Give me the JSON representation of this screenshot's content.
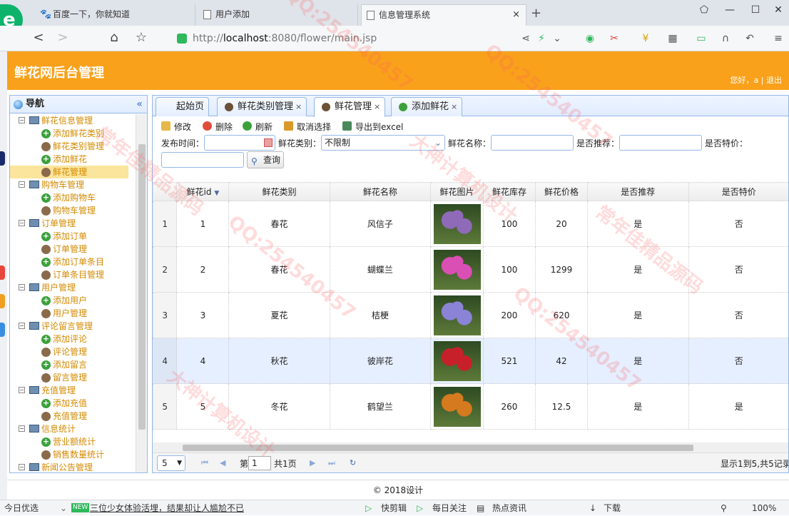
{
  "browser": {
    "tabs": [
      {
        "title": "百度一下，你就知道"
      },
      {
        "title": "用户添加"
      },
      {
        "title": "信息管理系统"
      }
    ],
    "new_tab": "+",
    "url_prefix": "http://",
    "url_host": "localhost",
    "url_path": ":8080/flower/main.jsp",
    "zoom": "100%"
  },
  "header": {
    "title": "鲜花网后台管理",
    "user_text": "您好，a | 退出"
  },
  "nav": {
    "title": "导航",
    "collapse": "«",
    "groups": [
      {
        "label": "鲜花信息管理",
        "items": [
          {
            "label": "添加鲜花类别",
            "type": "add"
          },
          {
            "label": "鲜花类别管理",
            "type": "man"
          },
          {
            "label": "添加鲜花",
            "type": "add"
          },
          {
            "label": "鲜花管理",
            "type": "man",
            "selected": true
          }
        ]
      },
      {
        "label": "购物车管理",
        "items": [
          {
            "label": "添加购物车",
            "type": "add"
          },
          {
            "label": "购物车管理",
            "type": "man"
          }
        ]
      },
      {
        "label": "订单管理",
        "items": [
          {
            "label": "添加订单",
            "type": "add"
          },
          {
            "label": "订单管理",
            "type": "man"
          },
          {
            "label": "添加订单条目",
            "type": "add"
          },
          {
            "label": "订单条目管理",
            "type": "man"
          }
        ]
      },
      {
        "label": "用户管理",
        "items": [
          {
            "label": "添加用户",
            "type": "add"
          },
          {
            "label": "用户管理",
            "type": "man"
          }
        ]
      },
      {
        "label": "评论留言管理",
        "items": [
          {
            "label": "添加评论",
            "type": "add"
          },
          {
            "label": "评论管理",
            "type": "man"
          },
          {
            "label": "添加留言",
            "type": "add"
          },
          {
            "label": "留言管理",
            "type": "man"
          }
        ]
      },
      {
        "label": "充值管理",
        "items": [
          {
            "label": "添加充值",
            "type": "add"
          },
          {
            "label": "充值管理",
            "type": "man"
          }
        ]
      },
      {
        "label": "信息统计",
        "items": [
          {
            "label": "营业额统计",
            "type": "add"
          },
          {
            "label": "销售数量统计",
            "type": "man"
          }
        ]
      },
      {
        "label": "新闻公告管理",
        "items": []
      }
    ]
  },
  "main_tabs": [
    {
      "label": "起始页",
      "icon": "none",
      "closable": false
    },
    {
      "label": "鲜花类别管理",
      "icon": "man",
      "closable": true
    },
    {
      "label": "鲜花管理",
      "icon": "man",
      "closable": true,
      "active": true
    },
    {
      "label": "添加鲜花",
      "icon": "add",
      "closable": true
    }
  ],
  "close_glyph": "×",
  "toolbar": {
    "edit": "修改",
    "delete": "删除",
    "refresh": "刷新",
    "unselect": "取消选择",
    "export": "导出到excel"
  },
  "search": {
    "publish_time_label": "发布时间：",
    "category_label": "鲜花类别：",
    "category_value": "不限制",
    "name_label": "鲜花名称：",
    "recommend_label": "是否推荐：",
    "special_label": "是否特价：",
    "query_button": "查询"
  },
  "grid": {
    "columns": [
      "鲜花id",
      "鲜花类别",
      "鲜花名称",
      "鲜花图片",
      "鲜花库存",
      "鲜花价格",
      "是否推荐",
      "是否特价"
    ],
    "rows": [
      {
        "rn": "1",
        "id": "1",
        "category": "春花",
        "name": "风信子",
        "stock": "100",
        "price": "20",
        "recommend": "是",
        "special": "否"
      },
      {
        "rn": "2",
        "id": "2",
        "category": "春花",
        "name": "蝴蝶兰",
        "stock": "100",
        "price": "1299",
        "recommend": "是",
        "special": "否"
      },
      {
        "rn": "3",
        "id": "3",
        "category": "夏花",
        "name": "桔梗",
        "stock": "200",
        "price": "620",
        "recommend": "是",
        "special": "否"
      },
      {
        "rn": "4",
        "id": "4",
        "category": "秋花",
        "name": "彼岸花",
        "stock": "521",
        "price": "42",
        "recommend": "是",
        "special": "否",
        "highlight": true
      },
      {
        "rn": "5",
        "id": "5",
        "category": "冬花",
        "name": "鹤望兰",
        "stock": "260",
        "price": "12.5",
        "recommend": "是",
        "special": "是"
      }
    ],
    "flower_colors": [
      "#8f6ab8",
      "#d94fb4",
      "#8b84d6",
      "#c8202a",
      "#d57a1e"
    ]
  },
  "pager": {
    "page_size": "5",
    "page_prefix": "第",
    "page_value": "1",
    "page_total": "共1页",
    "info": "显示1到5,共5记录"
  },
  "footer": "© 2018设计",
  "statusbar": {
    "left": "今日优选",
    "new_badge": "NEW",
    "headline": "三位少女体验活埋，结果却让人尴尬不已",
    "items": [
      "快剪辑",
      "每日关注",
      "热点资讯",
      "下载"
    ],
    "zoom": "100%"
  },
  "watermarks": [
    "QQ:254540457",
    "大神计算机设计",
    "常年佳精品源码"
  ]
}
